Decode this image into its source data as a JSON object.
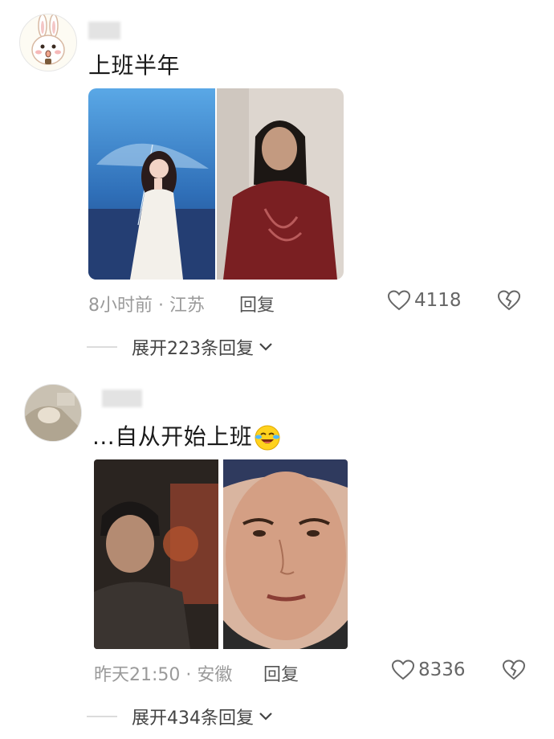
{
  "comments": [
    {
      "text": "上班半年",
      "time_location": "8小时前 · 江苏",
      "reply_label": "回复",
      "likes": "4118",
      "expand_label": "展开223条回复"
    },
    {
      "text": "...自从开始上班",
      "emoji": "crying-laughing-emoji",
      "time_location": "昨天21:50 · 安徽",
      "reply_label": "回复",
      "likes": "8336",
      "expand_label": "展开434条回复"
    }
  ],
  "icons": {
    "like": "heart-outline-icon",
    "dislike": "broken-heart-icon",
    "expand": "chevron-down-icon"
  },
  "colors": {
    "meta_text": "#9a9a9a",
    "icon_gray": "#666666"
  }
}
